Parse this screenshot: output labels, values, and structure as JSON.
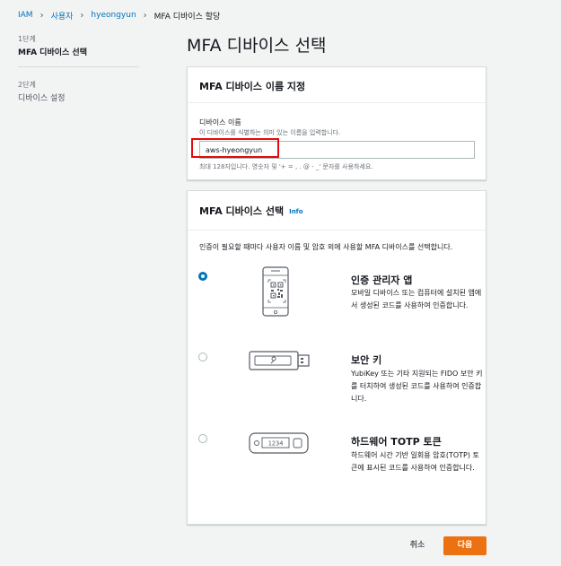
{
  "breadcrumb": {
    "items": [
      "IAM",
      "사용자",
      "hyeongyun"
    ],
    "current": "MFA 디바이스 할당"
  },
  "steps": [
    {
      "step": "1단계",
      "label": "MFA 디바이스 선택"
    },
    {
      "step": "2단계",
      "label": "디바이스 설정"
    }
  ],
  "page_title": "MFA 디바이스 선택",
  "name_panel": {
    "title": "MFA 디바이스 이름 지정",
    "label": "디바이스 이름",
    "description": "이 디바이스를 식별하는 의미 있는 이름을 입력합니다.",
    "value": "aws-hyeongyun",
    "constraint": "최대 128자입니다. 영숫자 및 '+ = , . @ - _' 문자를 사용하세요."
  },
  "device_panel": {
    "title": "MFA 디바이스 선택",
    "info": "Info",
    "intro": "인증이 필요할 때마다 사용자 이름 및 암호 외에 사용할 MFA 디바이스를 선택합니다.",
    "options": [
      {
        "title": "인증 관리자 앱",
        "desc": "모바일 디바이스 또는 컴퓨터에 설치된 앱에서 생성된 코드를 사용하여 인증합니다.",
        "selected": true,
        "icon": "smartphone-qr-icon"
      },
      {
        "title": "보안 키",
        "desc": "YubiKey 또는 기타 지원되는 FIDO 보안 키를 터치하여 생성된 코드를 사용하여 인증합니다.",
        "selected": false,
        "icon": "usb-security-key-icon"
      },
      {
        "title": "하드웨어 TOTP 토큰",
        "desc": "하드웨어 시간 기반 일회용 암호(TOTP) 토큰에 표시된 코드를 사용하여 인증합니다.",
        "selected": false,
        "icon": "hardware-token-icon",
        "token_display": "1234"
      }
    ]
  },
  "footer": {
    "cancel": "취소",
    "next": "다음"
  },
  "colors": {
    "link": "#0073bb",
    "primary_button": "#ec7211",
    "highlight": "#e40a0a",
    "background": "#f2f3f3"
  }
}
